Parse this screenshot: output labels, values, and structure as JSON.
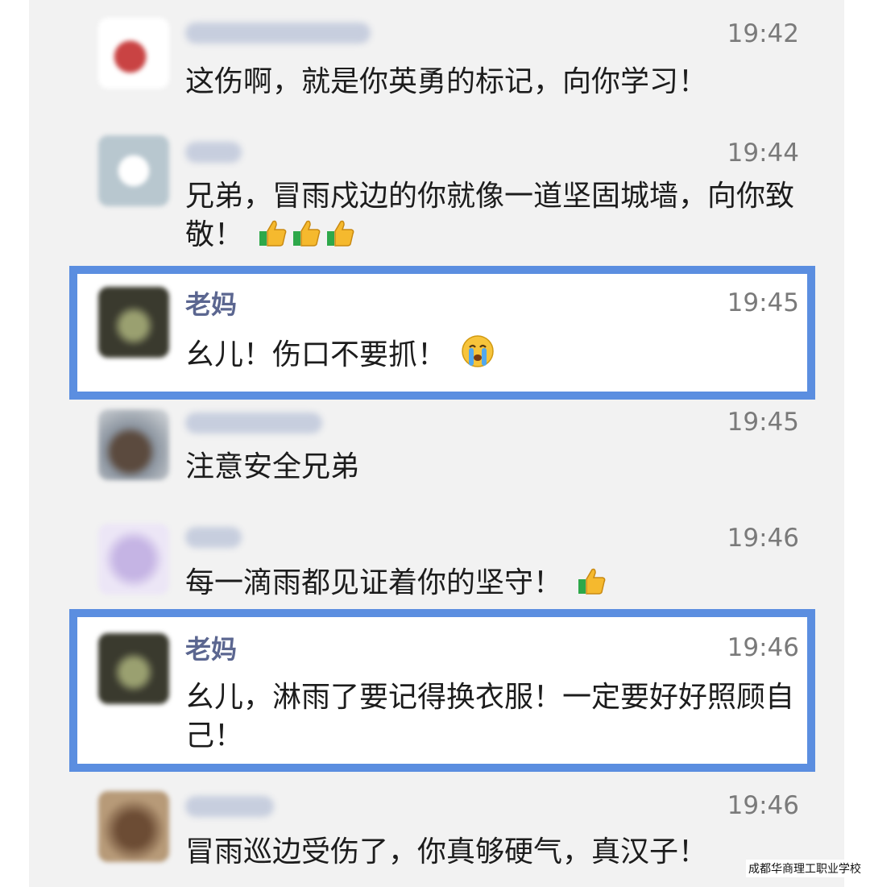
{
  "comments": [
    {
      "name": "",
      "time": "19:42",
      "text": "这伤啊，就是你英勇的标记，向你学习！",
      "emoji": []
    },
    {
      "name": "",
      "time": "19:44",
      "text": "兄弟，冒雨戍边的你就像一道坚固城墙，向你致敬！",
      "emoji": [
        "thumbs-up",
        "thumbs-up",
        "thumbs-up"
      ]
    },
    {
      "name": "老妈",
      "time": "19:45",
      "text": "幺儿！伤口不要抓！",
      "emoji": [
        "crying-face"
      ]
    },
    {
      "name": "",
      "time": "19:45",
      "text": "注意安全兄弟",
      "emoji": []
    },
    {
      "name": "",
      "time": "19:46",
      "text": "每一滴雨都见证着你的坚守！",
      "emoji": [
        "thumbs-up"
      ]
    },
    {
      "name": "老妈",
      "time": "19:46",
      "text": "幺儿，淋雨了要记得换衣服！一定要好好照顾自己！",
      "emoji": []
    },
    {
      "name": "",
      "time": "19:46",
      "text": "冒雨巡边受伤了，你真够硬气，真汉子！",
      "emoji": []
    }
  ],
  "watermark": "成都华商理工职业学校",
  "colors": {
    "highlight_border": "#5b8ee0",
    "mom_name": "#5b6690"
  }
}
